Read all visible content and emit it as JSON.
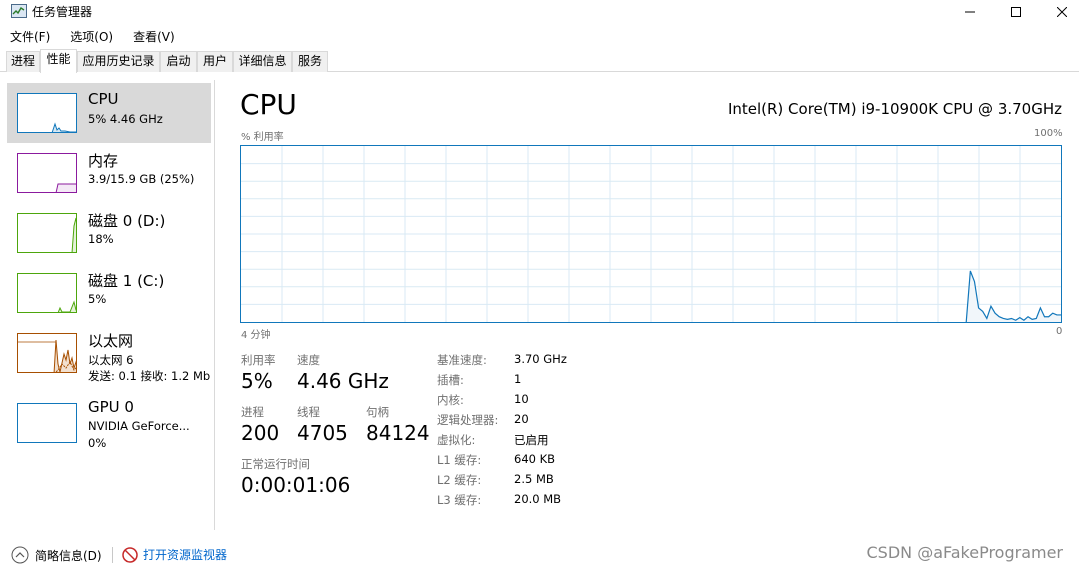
{
  "window": {
    "title": "任务管理器",
    "minimize_icon": "minimize-icon",
    "maximize_icon": "maximize-icon",
    "close_icon": "close-icon"
  },
  "menu": [
    "文件(F)",
    "选项(O)",
    "查看(V)"
  ],
  "tabs": [
    "进程",
    "性能",
    "应用历史记录",
    "启动",
    "用户",
    "详细信息",
    "服务"
  ],
  "active_tab": "性能",
  "sidebar": [
    {
      "title": "CPU",
      "sub": "5% 4.46 GHz",
      "sub2": "",
      "color": "#1177bb",
      "level_percent": 5
    },
    {
      "title": "内存",
      "sub": "3.9/15.9 GB (25%)",
      "sub2": "",
      "color": "#8b1a9e",
      "level_percent": 25
    },
    {
      "title": "磁盘 0 (D:)",
      "sub": "18%",
      "sub2": "",
      "color": "#4da60c",
      "level_percent": 18
    },
    {
      "title": "磁盘 1 (C:)",
      "sub": "5%",
      "sub2": "",
      "color": "#4da60c",
      "level_percent": 5
    },
    {
      "title": "以太网",
      "sub": "以太网 6",
      "sub2": "发送: 0.1  接收: 1.2 Mb",
      "color": "#a74f01"
    },
    {
      "title": "GPU 0",
      "sub": "NVIDIA GeForce...",
      "sub2": "0%",
      "color": "#1177bb",
      "level_percent": 0
    }
  ],
  "main": {
    "title": "CPU",
    "model": "Intel(R) Core(TM) i9-10900K CPU @ 3.70GHz",
    "graph_label_left": "% 利用率",
    "graph_label_right": "100%",
    "time_left": "4 分钟",
    "time_right": "0",
    "graph_color": "#1177bb",
    "graph_fill": "#f1f6fa",
    "grid_color": "#d9eaf4",
    "stats": {
      "util_label": "利用率",
      "util_value": "5%",
      "speed_label": "速度",
      "speed_value": "4.46 GHz",
      "proc_label": "进程",
      "proc_value": "200",
      "thread_label": "线程",
      "thread_value": "4705",
      "handle_label": "句柄",
      "handle_value": "84124",
      "uptime_label": "正常运行时间",
      "uptime_value": "0:00:01:06"
    },
    "specs": [
      {
        "label": "基准速度:",
        "value": "3.70 GHz"
      },
      {
        "label": "插槽:",
        "value": "1"
      },
      {
        "label": "内核:",
        "value": "10"
      },
      {
        "label": "逻辑处理器:",
        "value": "20"
      },
      {
        "label": "虚拟化:",
        "value": "已启用"
      },
      {
        "label": "L1 缓存:",
        "value": "640 KB"
      },
      {
        "label": "L2 缓存:",
        "value": "2.5 MB"
      },
      {
        "label": "L3 缓存:",
        "value": "20.0 MB"
      }
    ]
  },
  "chart_data": {
    "type": "area",
    "ylim": [
      0,
      100
    ],
    "y_unit": "%",
    "x_range_label": "4 分钟",
    "grid": true,
    "values": [
      0,
      0,
      0,
      0,
      0,
      0,
      0,
      0,
      0,
      0,
      0,
      0,
      0,
      0,
      0,
      0,
      0,
      0,
      0,
      0,
      0,
      0,
      0,
      0,
      0,
      0,
      0,
      0,
      0,
      0,
      0,
      0,
      0,
      0,
      0,
      0,
      0,
      0,
      0,
      0,
      0,
      0,
      0,
      0,
      0,
      0,
      0,
      0,
      0,
      0,
      0,
      0,
      0,
      0,
      0,
      0,
      0,
      0,
      0,
      0,
      0,
      0,
      0,
      0,
      0,
      0,
      0,
      0,
      0,
      0,
      0,
      0,
      0,
      0,
      0,
      0,
      0,
      0,
      0,
      0,
      0,
      0,
      0,
      0,
      0,
      0,
      0,
      0,
      0,
      0,
      0,
      0,
      0,
      0,
      0,
      0,
      0,
      0,
      0,
      0,
      0,
      0,
      0,
      0,
      0,
      0,
      0,
      0,
      0,
      0,
      0,
      0,
      0,
      0,
      0,
      0,
      0,
      0,
      0,
      0,
      0,
      0,
      0,
      0,
      0,
      0,
      0,
      0,
      0,
      0,
      0,
      0,
      0,
      0,
      0,
      0,
      0,
      0,
      0,
      0,
      0,
      0,
      0,
      0,
      0,
      0,
      0,
      0,
      0,
      0,
      0,
      0,
      0,
      0,
      0,
      0,
      0,
      0,
      0,
      0,
      0,
      0,
      0,
      0,
      0,
      0,
      0,
      0,
      0,
      0,
      0,
      0,
      0,
      0,
      0,
      0,
      0,
      29,
      23,
      8,
      6,
      2,
      9,
      5,
      3,
      2,
      1.5,
      2,
      1,
      2.5,
      1,
      3,
      1.5,
      2,
      8,
      3,
      3,
      5,
      4,
      4
    ]
  },
  "footer": {
    "less_details": "简略信息(D)",
    "open_monitor": "打开资源监视器"
  },
  "watermark": "CSDN @aFakeProgramer"
}
